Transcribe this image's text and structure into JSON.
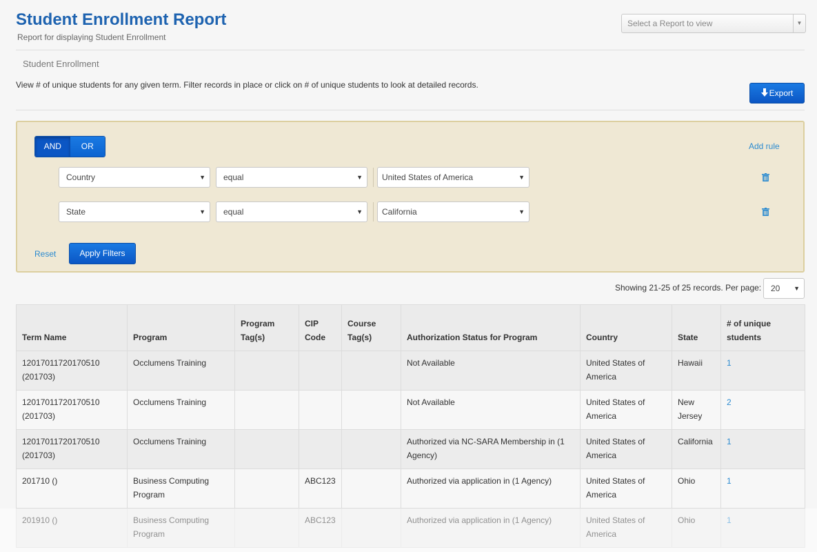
{
  "header": {
    "title": "Student Enrollment Report",
    "subtitle": "Report for displaying Student Enrollment",
    "report_select_placeholder": "Select a Report to view"
  },
  "section": {
    "title": "Student Enrollment",
    "description": "View # of unique students for any given term. Filter records in place or click on # of unique students to look at detailed records.",
    "export_label": "Export"
  },
  "filters": {
    "and_label": "AND",
    "or_label": "OR",
    "active_condition": "AND",
    "add_rule_label": "Add rule",
    "rules": [
      {
        "field": "Country",
        "operator": "equal",
        "value": "United States of America"
      },
      {
        "field": "State",
        "operator": "equal",
        "value": "California"
      }
    ],
    "reset_label": "Reset",
    "apply_label": "Apply Filters"
  },
  "pagination": {
    "showing_text": "Showing 21-25 of 25 records. Per page:",
    "per_page": "20"
  },
  "table": {
    "headers": [
      "Term Name",
      "Program",
      "Program Tag(s)",
      "CIP Code",
      "Course Tag(s)",
      "Authorization Status for Program",
      "Country",
      "State",
      "# of unique students"
    ],
    "rows": [
      {
        "term": "12017011720170510 (201703)",
        "program": "Occlumens Training",
        "program_tags": "",
        "cip": "",
        "course_tags": "",
        "auth": "Not Available",
        "country": "United States of America",
        "state": "Hawaii",
        "count": "1"
      },
      {
        "term": "12017011720170510 (201703)",
        "program": "Occlumens Training",
        "program_tags": "",
        "cip": "",
        "course_tags": "",
        "auth": "Not Available",
        "country": "United States of America",
        "state": "New Jersey",
        "count": "2"
      },
      {
        "term": "12017011720170510 (201703)",
        "program": "Occlumens Training",
        "program_tags": "",
        "cip": "",
        "course_tags": "",
        "auth": "Authorized via NC-SARA Membership in (1 Agency)",
        "country": "United States of America",
        "state": "California",
        "count": "1"
      },
      {
        "term": "201710 ()",
        "program": "Business Computing Program",
        "program_tags": "",
        "cip": "ABC123",
        "course_tags": "",
        "auth": "Authorized via application in (1 Agency)",
        "country": "United States of America",
        "state": "Ohio",
        "count": "1"
      },
      {
        "term": "201910 ()",
        "program": "Business Computing Program",
        "program_tags": "",
        "cip": "ABC123",
        "course_tags": "",
        "auth": "Authorized via application in (1 Agency)",
        "country": "United States of America",
        "state": "Ohio",
        "count": "1"
      }
    ]
  },
  "colors": {
    "title_blue": "#1e63b0",
    "button_blue": "#0b56c4",
    "link_blue": "#2a8ad0",
    "filter_bg": "#efe8d4",
    "filter_border": "#dccf9f"
  }
}
